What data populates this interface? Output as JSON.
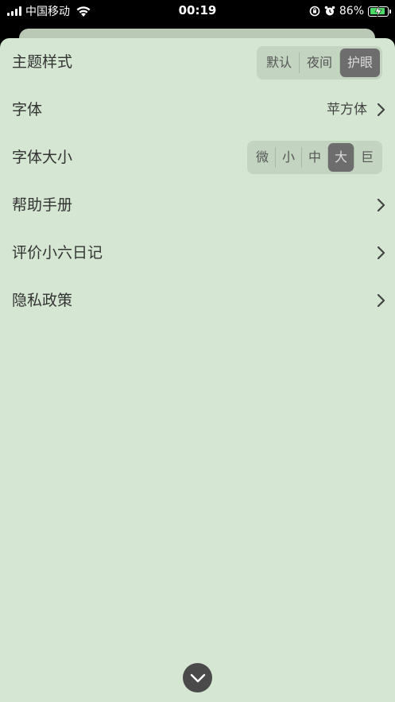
{
  "status_bar": {
    "carrier": "中国移动",
    "time": "00:19",
    "battery_percent": "86%",
    "battery_level": 0.86,
    "colors": {
      "battery_fill": "#4cd964"
    }
  },
  "settings": {
    "theme": {
      "label": "主题样式",
      "options": [
        "默认",
        "夜间",
        "护眼"
      ],
      "selected_index": 2
    },
    "font": {
      "label": "字体",
      "value": "苹方体"
    },
    "font_size": {
      "label": "字体大小",
      "options": [
        "微",
        "小",
        "中",
        "大",
        "巨"
      ],
      "selected_index": 3
    },
    "help": {
      "label": "帮助手册"
    },
    "rate": {
      "label": "评价小六日记"
    },
    "privacy": {
      "label": "隐私政策"
    }
  },
  "icons": {
    "chevron": "chevron-right-icon",
    "collapse": "chevron-down-icon"
  },
  "colors": {
    "sheet_background": "#d5e6d3",
    "segment_selected": "#6d6d6d"
  }
}
